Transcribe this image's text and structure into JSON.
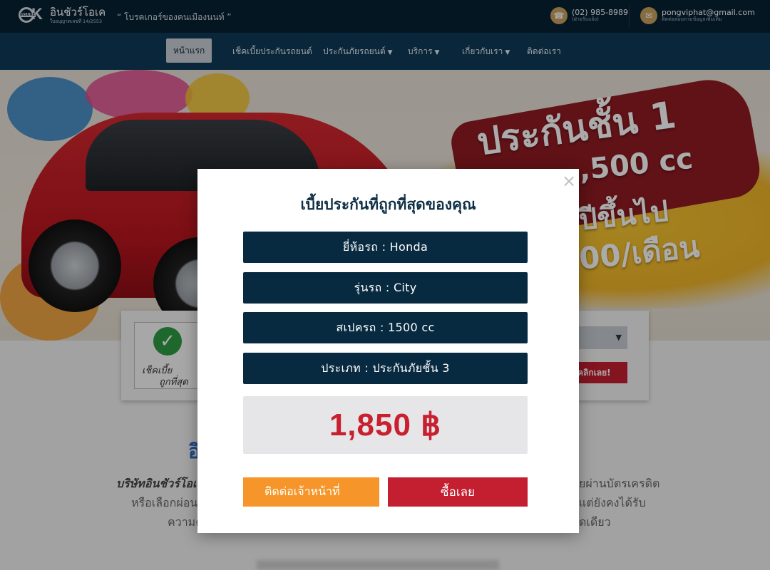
{
  "header": {
    "logo_title": "อินชัวร์โอเค",
    "logo_license": "ใบอนุญาตเลขที่ 14/2553",
    "logo_mark_text": "INSURE",
    "slogan": "“ โบรคเกอร์ของคนเมืองนนท์ ”",
    "phone": "(02) 985-8989",
    "phone_sub": "(ฝ่ายรับแจ้ง)",
    "email": "pongviphat@gmail.com",
    "email_sub": "ติดต่อสอบถามข้อมูลเพิ่มเติม"
  },
  "nav": {
    "items": [
      {
        "label": "หน้าแรก"
      },
      {
        "label": "เช็คเบี้ยประกันรถยนต์"
      },
      {
        "label": "ประกันภัยรถยนต์"
      },
      {
        "label": "บริการ"
      },
      {
        "label": "เกี่ยวกับเรา"
      },
      {
        "label": "ติดต่อเรา"
      }
    ],
    "caret": "▼"
  },
  "hero": {
    "line1": "ประกันชั้น 1",
    "line2": ",500 cc",
    "line3": "ปีขึ้นไป",
    "line4": "00/เดือน"
  },
  "check_card": {
    "label_line1": "เช็คเบี้ย",
    "label_line2": "ถูกที่สุด",
    "select_caret": "▼",
    "button_label": "คลิกเลย!"
  },
  "about": {
    "heading": "อิ",
    "line1_bold": "บริษัทอินชัวร์โอเค",
    "line1_right": "ยผ่านบัตรเครดิต",
    "line2_left": "หรือเลือกผ่อน",
    "line2_right": "แต่ยังคงได้รับ",
    "line3_left": "ความค",
    "line3_right": "ดเดียว"
  },
  "modal": {
    "close_symbol": "×",
    "title": "เบี้ยประกันที่ถูกที่สุดของคุณ",
    "rows": [
      {
        "label": "ยี่ห้อรถ : Honda"
      },
      {
        "label": "รุ่นรถ : City"
      },
      {
        "label": "สเปครถ : 1500 cc"
      },
      {
        "label": "ประเภท : ประกันภัยชั้น 3"
      }
    ],
    "price": "1,850 ฿",
    "contact_button": "ติดต่อเจ้าหน้าที่",
    "buy_button": "ซื้อเลย"
  },
  "colors": {
    "navy": "#082235",
    "nav": "#0e3a57",
    "price_red": "#c8202f",
    "orange": "#f6962a",
    "gold": "#c8a25d"
  }
}
